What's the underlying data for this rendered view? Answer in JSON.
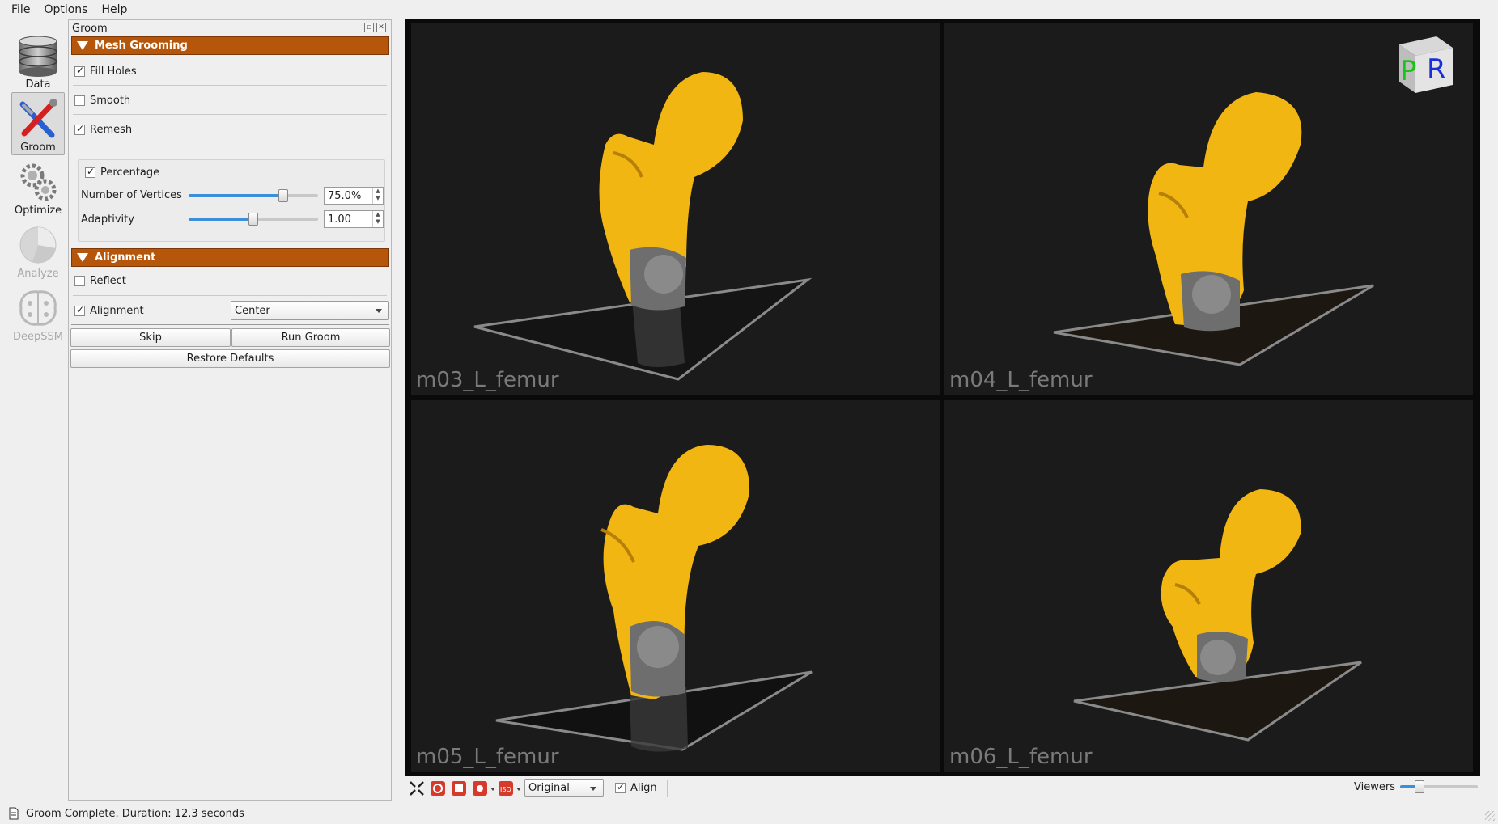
{
  "menu": [
    "File",
    "Options",
    "Help"
  ],
  "toolbar": {
    "tools": [
      {
        "label": "Data",
        "icon": "database-icon",
        "active": false,
        "enabled": true
      },
      {
        "label": "Groom",
        "icon": "groom-tools-icon",
        "active": true,
        "enabled": true
      },
      {
        "label": "Optimize",
        "icon": "gears-icon",
        "active": false,
        "enabled": true
      },
      {
        "label": "Analyze",
        "icon": "pie-chart-icon",
        "active": false,
        "enabled": false
      },
      {
        "label": "DeepSSM",
        "icon": "brain-icon",
        "active": false,
        "enabled": false
      }
    ]
  },
  "panel": {
    "title": "Groom",
    "mesh_grooming": {
      "header": "Mesh Grooming",
      "fill_holes": {
        "label": "Fill Holes",
        "checked": true
      },
      "smooth": {
        "label": "Smooth",
        "checked": false
      },
      "remesh": {
        "label": "Remesh",
        "checked": true
      },
      "percentage": {
        "label": "Percentage",
        "checked": true
      },
      "num_vertices": {
        "label": "Number of Vertices",
        "value": "75.0%",
        "slider_level": 0.73
      },
      "adaptivity": {
        "label": "Adaptivity",
        "value": "1.00",
        "slider_level": 0.5
      }
    },
    "alignment": {
      "header": "Alignment",
      "reflect": {
        "label": "Reflect",
        "checked": false
      },
      "alignment": {
        "label": "Alignment",
        "checked": true,
        "selected": "Center"
      }
    },
    "buttons": {
      "skip": "Skip",
      "run": "Run Groom",
      "restore": "Restore Defaults"
    }
  },
  "viewer": {
    "labels": [
      "m03_L_femur",
      "m04_L_femur",
      "m05_L_femur",
      "m06_L_femur"
    ],
    "orientation_cube": {
      "p": "P",
      "r": "R"
    },
    "bone_color": "#f2b612",
    "scan_color": "#6e6e6e"
  },
  "viewer_toolbar": {
    "display_mode": "Original",
    "align": {
      "label": "Align",
      "checked": true
    },
    "viewers_label": "Viewers",
    "viewers_level": 0.25
  },
  "status": "Groom Complete.  Duration: 12.3 seconds"
}
